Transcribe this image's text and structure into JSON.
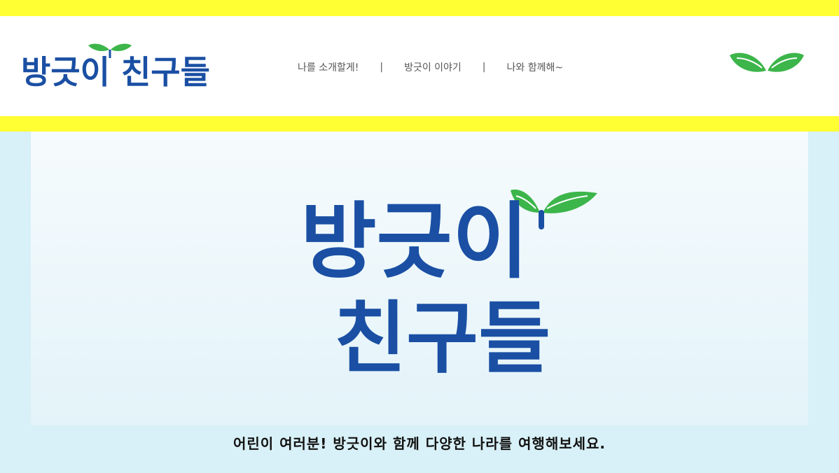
{
  "site": {
    "logo_text": "방긋이 친구들"
  },
  "nav": {
    "items": [
      {
        "label": "나를 소개할게!"
      },
      {
        "label": "방긋이 이야기"
      },
      {
        "label": "나와 함께해~"
      }
    ],
    "separator": "|"
  },
  "hero": {
    "logo_line1": "방긋이",
    "logo_line2": "친구들",
    "caption": "어린이 여러분! 방긋이와 함께 다양한 나라를 여행해보세요."
  },
  "colors": {
    "accent_yellow": "#ffff33",
    "brand_blue": "#1a4fa3",
    "leaf_green": "#3cb54a",
    "hero_bg": "#d8f0f7"
  },
  "icons": {
    "header_right": "leaf-sprout-icon"
  }
}
